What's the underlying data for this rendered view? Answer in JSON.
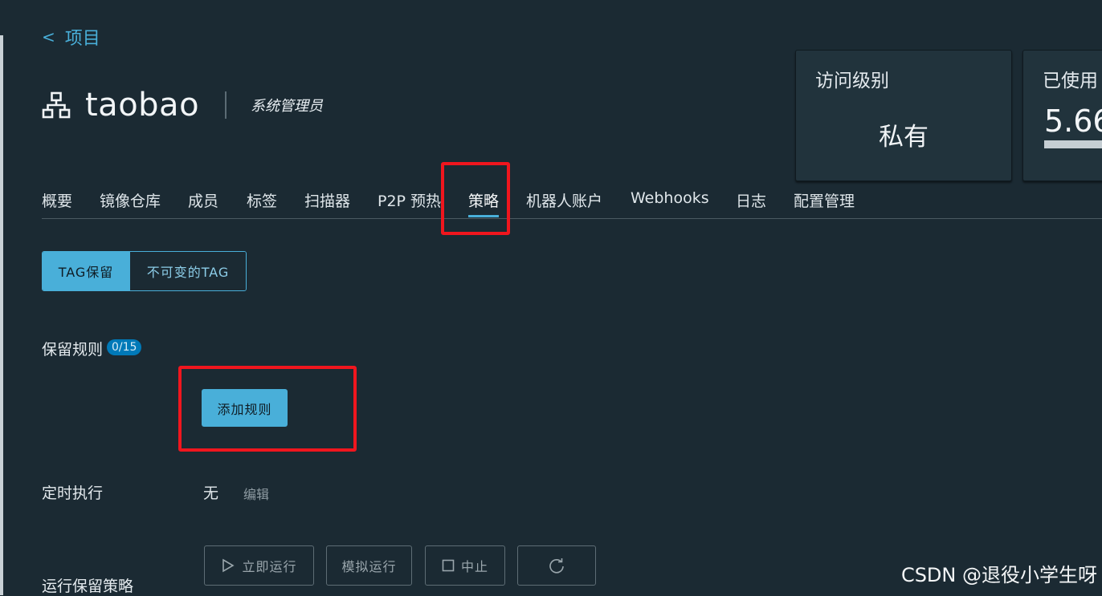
{
  "nav": {
    "back_label": "项目"
  },
  "project": {
    "name": "taobao",
    "role": "系统管理员"
  },
  "cards": {
    "access": {
      "title": "访问级别",
      "value": "私有"
    },
    "usage": {
      "title": "已使用",
      "value": "5.66",
      "fill_fraction": 1.0
    }
  },
  "tabs": [
    {
      "label": "概要"
    },
    {
      "label": "镜像仓库"
    },
    {
      "label": "成员"
    },
    {
      "label": "标签"
    },
    {
      "label": "扫描器"
    },
    {
      "label": "P2P 预热"
    },
    {
      "label": "策略",
      "active": true
    },
    {
      "label": "机器人账户"
    },
    {
      "label": "Webhooks"
    },
    {
      "label": "日志"
    },
    {
      "label": "配置管理"
    }
  ],
  "segmented": {
    "retention": "TAG保留",
    "immutable": "不可变的TAG"
  },
  "retention": {
    "rules_label": "保留规则",
    "rules_count": "0/15",
    "add_rule": "添加规则",
    "schedule_label": "定时执行",
    "schedule_value": "无",
    "edit": "编辑",
    "run_label": "运行保留策略",
    "run_now": "立即运行",
    "dry_run": "模拟运行",
    "abort": "中止"
  },
  "icons": {
    "back": "chevron-left-icon",
    "project": "organization-icon",
    "run_now": "play-icon",
    "abort": "stop-icon",
    "refresh": "refresh-icon"
  },
  "colors": {
    "accent": "#49afd9",
    "highlight": "#f0161e",
    "badge": "#0079b8",
    "background": "#1b2a33"
  },
  "watermark": "CSDN @退役小学生呀"
}
